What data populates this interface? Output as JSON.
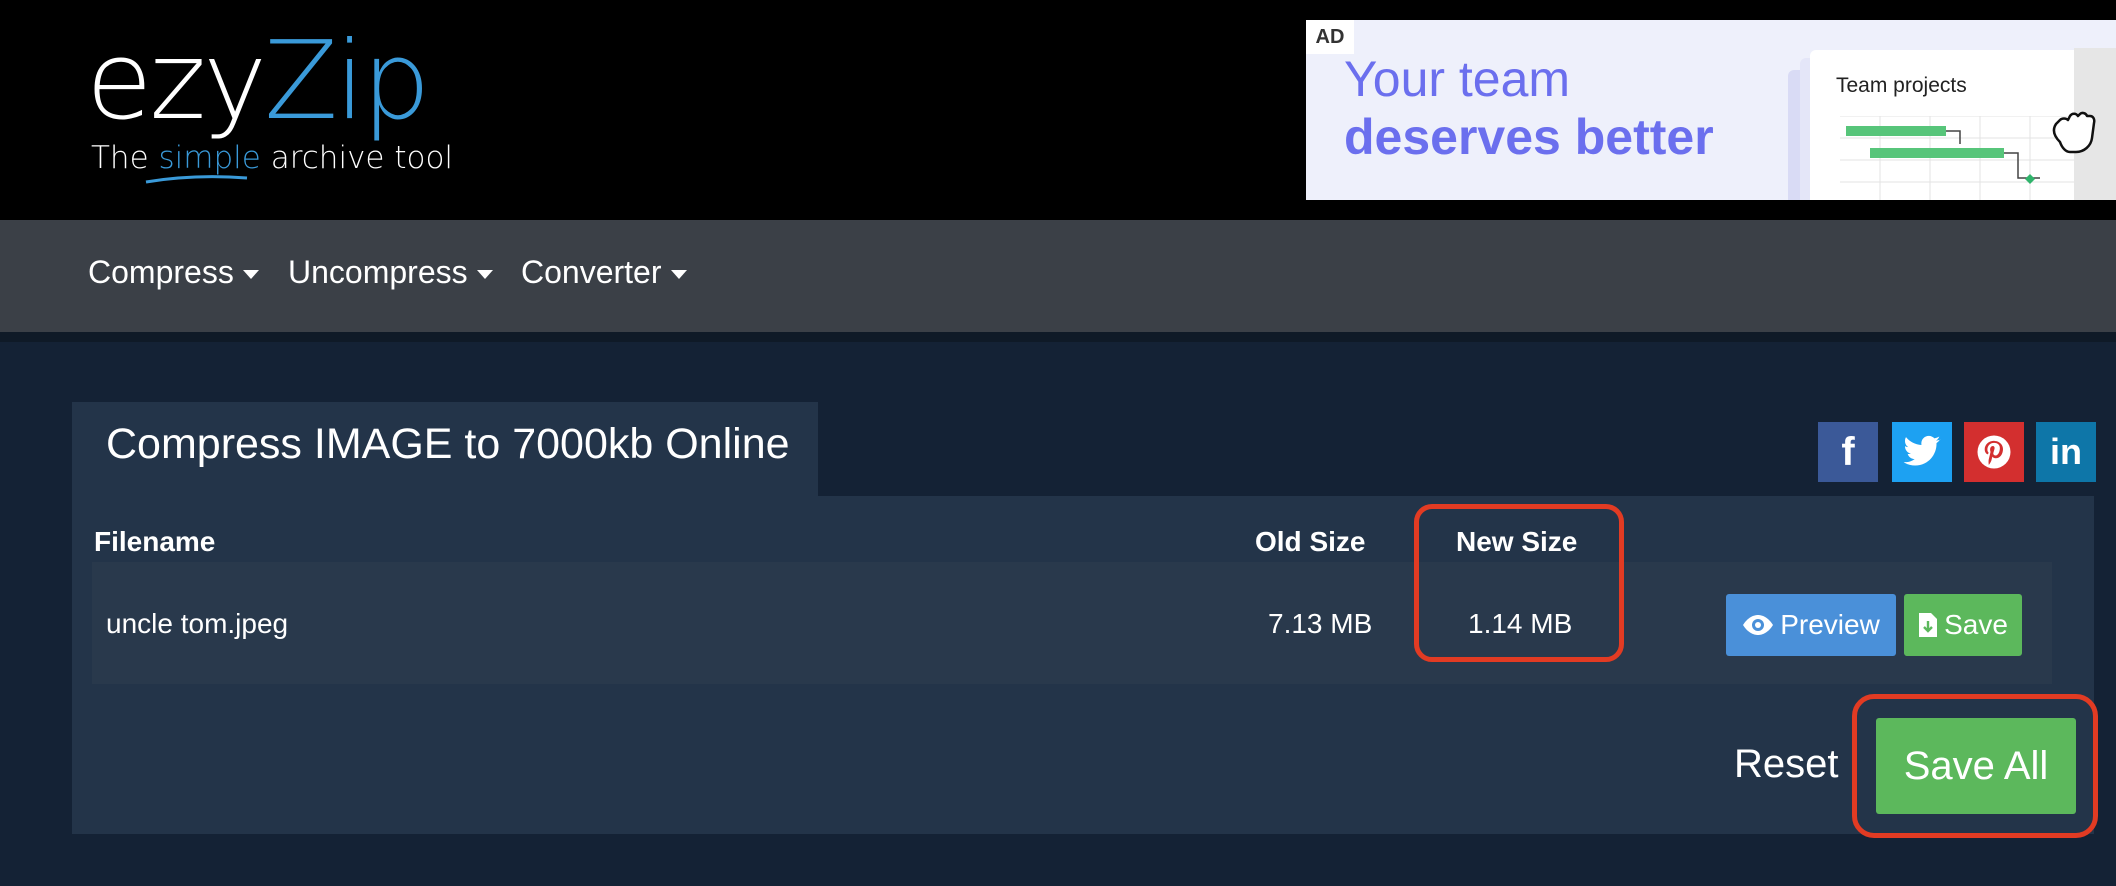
{
  "logo": {
    "part1": "ezy",
    "part2": "Zip",
    "tagline_before": "The ",
    "tagline_highlight": "simple",
    "tagline_after": " archive tool"
  },
  "ad": {
    "badge": "AD",
    "line1": "Your team",
    "line2": "deserves better",
    "card_title": "Team projects"
  },
  "nav": {
    "items": [
      "Compress",
      "Uncompress",
      "Converter"
    ]
  },
  "panel": {
    "title": "Compress IMAGE to 7000kb Online",
    "columns": {
      "filename": "Filename",
      "old_size": "Old Size",
      "new_size": "New Size"
    },
    "files": [
      {
        "filename": "uncle tom.jpeg",
        "old_size": "7.13 MB",
        "new_size": "1.14 MB",
        "preview_label": "Preview",
        "save_label": "Save"
      }
    ],
    "reset_label": "Reset",
    "save_all_label": "Save All"
  },
  "social": {
    "facebook": "f",
    "linkedin": "in"
  },
  "colors": {
    "header_bg": "#000000",
    "nav_bg": "#3b4047",
    "page_bg": "#142235",
    "panel_bg": "#233449",
    "brand_blue": "#3a9ad9",
    "preview_blue": "#4a90d9",
    "save_green": "#5cb85c",
    "highlight_red": "#e23b23"
  },
  "icons": [
    "eye-icon",
    "file-download-icon",
    "facebook-icon",
    "twitter-icon",
    "pinterest-icon",
    "linkedin-icon"
  ]
}
